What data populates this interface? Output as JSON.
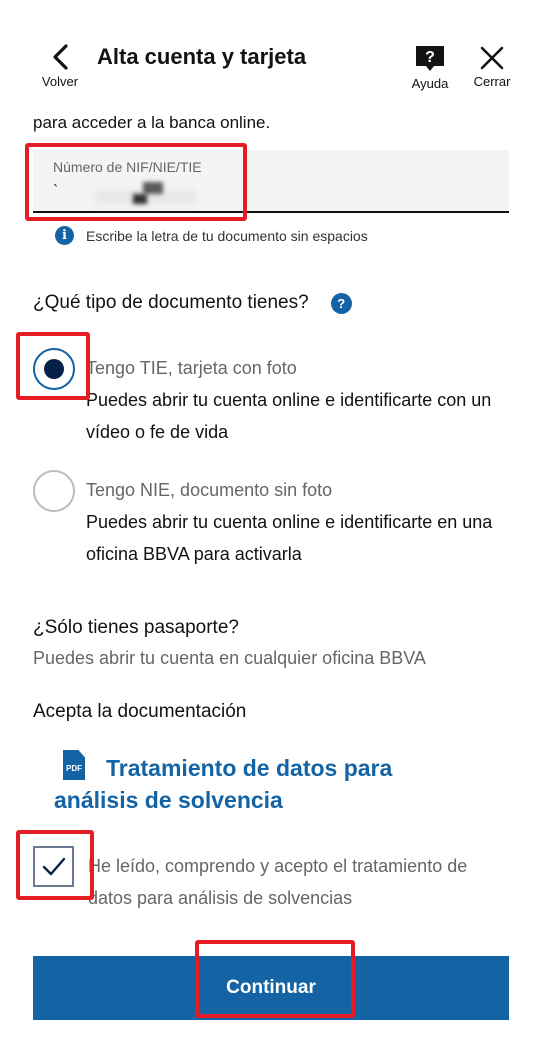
{
  "header": {
    "back_label": "Volver",
    "title": "Alta cuenta y tarjeta",
    "help_label": "Ayuda",
    "close_label": "Cerrar"
  },
  "intro_text": "para acceder a la banca online.",
  "document_field": {
    "label": "Número de NIF/NIE/TIE",
    "value": "`"
  },
  "hint": {
    "icon": "i",
    "text": "Escribe la letra de tu documento sin espacios"
  },
  "document_type": {
    "question": "¿Qué tipo de documento tienes?",
    "help_icon": "?",
    "options": [
      {
        "title": "Tengo TIE, tarjeta con foto",
        "description": "Puedes abrir tu cuenta online e identificarte con un vídeo o fe de vida",
        "selected": true
      },
      {
        "title": "Tengo NIE, documento sin foto",
        "description": "Puedes abrir tu cuenta online e identificarte en una oficina BBVA para activarla",
        "selected": false
      }
    ]
  },
  "passport": {
    "title": "¿Sólo tienes pasaporte?",
    "text": "Puedes abrir tu cuenta en cualquier oficina BBVA"
  },
  "documentation": {
    "title": "Acepta la documentación",
    "pdf_badge": "PDF",
    "link_text": "Tratamiento de datos para análisis de solvencia",
    "consent_text": "He leído, comprendo y acepto el tratamiento de datos para análisis de solvencias",
    "consent_checked": true
  },
  "continue_label": "Continuar",
  "colors": {
    "primary": "#1464a5",
    "navy": "#072146",
    "highlight": "#e41c23"
  }
}
